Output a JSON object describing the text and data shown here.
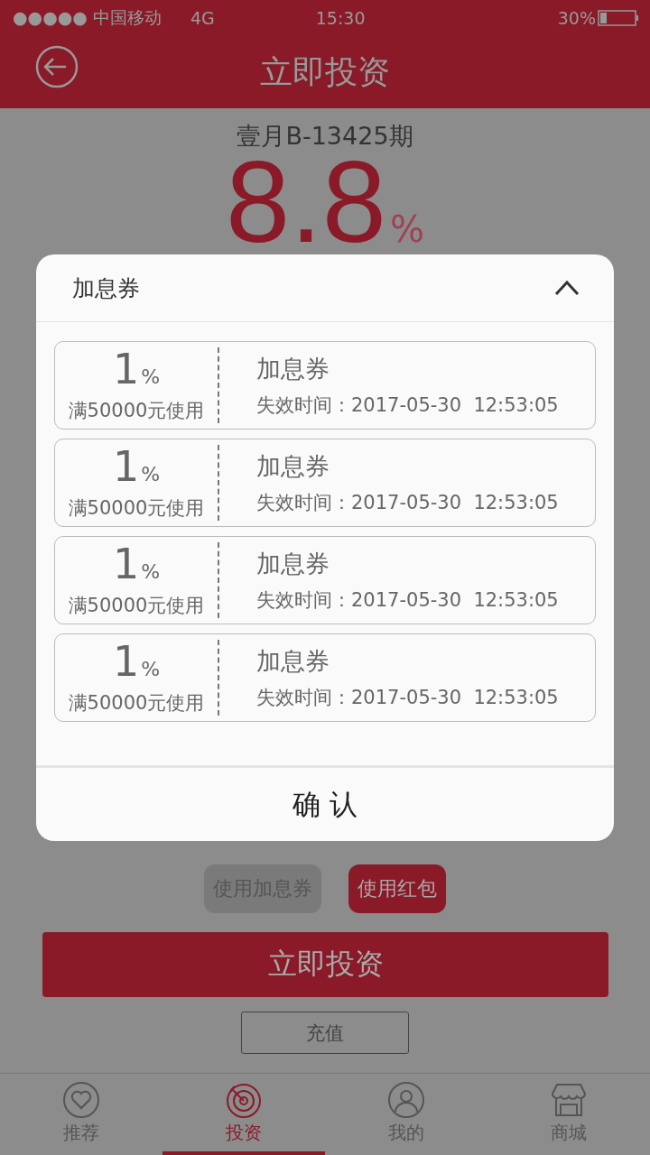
{
  "status_bar": {
    "carrier": "●●●●● 中国移动",
    "network": "4G",
    "time": "15:30",
    "battery": "30%"
  },
  "header": {
    "title": "立即投资"
  },
  "product": {
    "name": "壹月B-13425期",
    "rate": "8.8",
    "unit": "%"
  },
  "coupon_dialog": {
    "title": "加息券",
    "expanded": true,
    "confirm": "确 认",
    "coupons": [
      {
        "value": "1",
        "unit": "%",
        "condition": "满50000元使用",
        "name": "加息券",
        "expiry": "失效时间：2017-05-30  12:53:05"
      },
      {
        "value": "1",
        "unit": "%",
        "condition": "满50000元使用",
        "name": "加息券",
        "expiry": "失效时间：2017-05-30  12:53:05"
      },
      {
        "value": "1",
        "unit": "%",
        "condition": "满50000元使用",
        "name": "加息券",
        "expiry": "失效时间：2017-05-30  12:53:05"
      },
      {
        "value": "1",
        "unit": "%",
        "condition": "满50000元使用",
        "name": "加息券",
        "expiry": "失效时间：2017-05-30  12:53:05"
      }
    ]
  },
  "options": [
    {
      "label": "使用加息券",
      "selected": false
    },
    {
      "label": "使用红包",
      "selected": true
    }
  ],
  "invest_button": "立即投资",
  "recharge_button": "充值",
  "tabs": [
    {
      "label": "推荐",
      "kind": "heart",
      "selected": false
    },
    {
      "label": "投资",
      "kind": "target",
      "selected": true
    },
    {
      "label": "我的",
      "kind": "user",
      "selected": false
    },
    {
      "label": "商城",
      "kind": "shop",
      "selected": false
    }
  ]
}
